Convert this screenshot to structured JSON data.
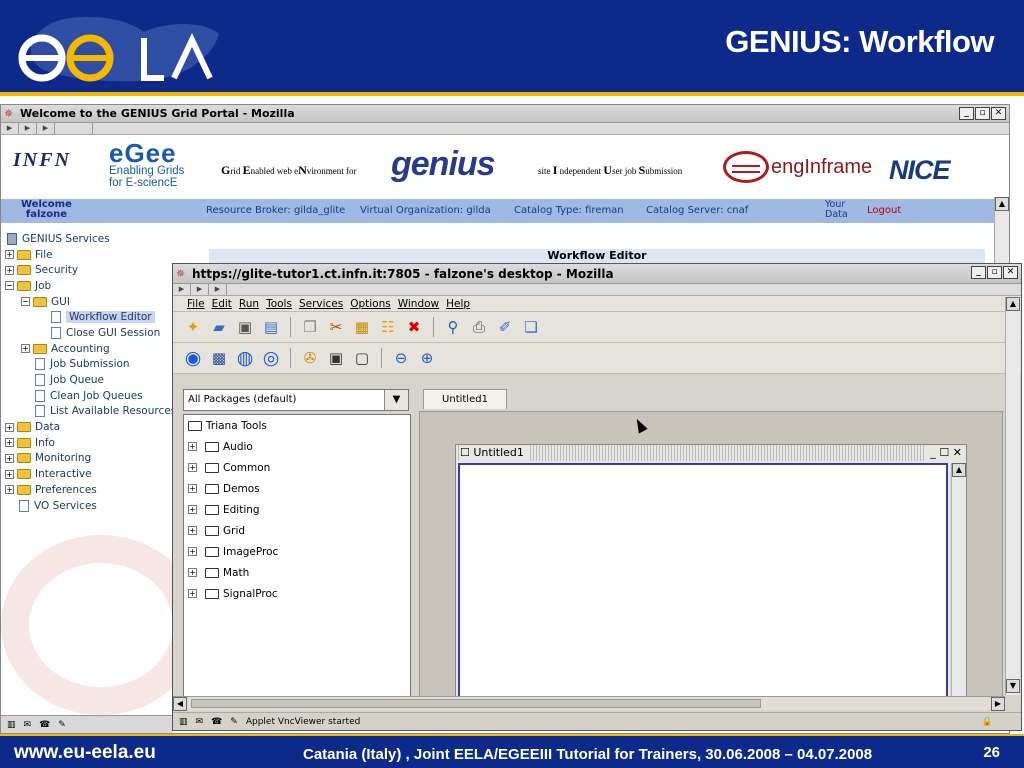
{
  "slide": {
    "title": "GENIUS: Workflow",
    "footer_url": "www.eu-eela.eu",
    "footer_text": "Catania (Italy) , Joint EELA/EGEEIII Tutorial for Trainers, 30.06.2008 – 04.07.2008",
    "page_number": "26",
    "colors": {
      "header_bg": "#0d2a8a",
      "accent": "#f5b800"
    }
  },
  "portal_window": {
    "title": "Welcome to the GENIUS Grid Portal - Mozilla",
    "logos": {
      "infn": "INFN",
      "egee": "eGee",
      "egee_sub1": "Enabling Grids",
      "egee_sub2": "for E-sciencE",
      "genius_desc": [
        "G",
        "rid ",
        "E",
        "nabled web e",
        "N",
        "vironment for"
      ],
      "genius": "genius",
      "site_desc": [
        "site ",
        "I",
        " ndependent ",
        "U",
        "ser job ",
        "S",
        "ubmission"
      ],
      "enginframe": "engInframe",
      "nice": "NICE"
    },
    "bar": {
      "welcome": "Welcome",
      "user": "falzone",
      "resource_broker": "Resource Broker: gilda_glite",
      "vo": "Virtual Organization: gilda",
      "catalog_type": "Catalog Type: fireman",
      "catalog_server": "Catalog Server: cnaf",
      "your": "Your",
      "data": "Data",
      "logout": "Logout"
    },
    "panel_title": "Workflow Editor",
    "tree": [
      {
        "label": "GENIUS Services",
        "level": 0,
        "kind": "root"
      },
      {
        "label": "File",
        "level": 0,
        "kind": "folder",
        "pm": "+"
      },
      {
        "label": "Security",
        "level": 0,
        "kind": "folder",
        "pm": "+"
      },
      {
        "label": "Job",
        "level": 0,
        "kind": "folder",
        "pm": "−"
      },
      {
        "label": "GUI",
        "level": 1,
        "kind": "folder",
        "pm": "−"
      },
      {
        "label": "Workflow Editor",
        "level": 2,
        "kind": "doc",
        "selected": true
      },
      {
        "label": "Close GUI Session",
        "level": 2,
        "kind": "doc"
      },
      {
        "label": "Accounting",
        "level": 1,
        "kind": "folder",
        "pm": "+"
      },
      {
        "label": "Job Submission",
        "level": 1,
        "kind": "doc"
      },
      {
        "label": "Job Queue",
        "level": 1,
        "kind": "doc"
      },
      {
        "label": "Clean Job Queues",
        "level": 1,
        "kind": "doc"
      },
      {
        "label": "List Available Resources",
        "level": 1,
        "kind": "doc"
      },
      {
        "label": "Data",
        "level": 0,
        "kind": "folder",
        "pm": "+"
      },
      {
        "label": "Info",
        "level": 0,
        "kind": "folder",
        "pm": "+"
      },
      {
        "label": "Monitoring",
        "level": 0,
        "kind": "folder",
        "pm": "+"
      },
      {
        "label": "Interactive",
        "level": 0,
        "kind": "folder",
        "pm": "+"
      },
      {
        "label": "Preferences",
        "level": 0,
        "kind": "folder",
        "pm": "+"
      },
      {
        "label": "VO Services",
        "level": 0,
        "kind": "doc"
      }
    ]
  },
  "vnc_window": {
    "title": "https://glite-tutor1.ct.infn.it:7805 - falzone's desktop - Mozilla",
    "menu": [
      "File",
      "Edit",
      "Run",
      "Tools",
      "Services",
      "Options",
      "Window",
      "Help"
    ],
    "packages_selected": "All Packages (default)",
    "tab_label": "Untitled1",
    "tools_root": "Triana Tools",
    "tools": [
      "Audio",
      "Common",
      "Demos",
      "Editing",
      "Grid",
      "ImageProc",
      "Math",
      "SignalProc"
    ],
    "inner_frame_title": "Untitled1",
    "status": "Applet VncViewer started"
  }
}
